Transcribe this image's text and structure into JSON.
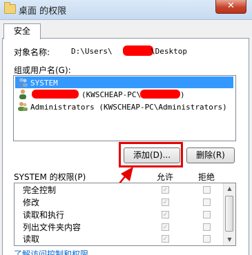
{
  "window": {
    "title": "桌面 的权限",
    "close_label": "✕"
  },
  "tabs": [
    {
      "label": "安全"
    }
  ],
  "object": {
    "label": "对象名称:",
    "path_prefix": "D:\\Users\\",
    "path_suffix": "\\Desktop"
  },
  "groups": {
    "label": "组或用户名(G):",
    "items": [
      {
        "name": "SYSTEM",
        "selected": true
      },
      {
        "name": "(KWSCHEAP-PC\\",
        "suffix": ")"
      },
      {
        "name": "Administrators (KWSCHEAP-PC\\Administrators)"
      }
    ]
  },
  "buttons": {
    "add": "添加(D)...",
    "remove": "删除(R)"
  },
  "permissions": {
    "label": "SYSTEM 的权限(P)",
    "allow_header": "允许",
    "deny_header": "拒绝",
    "rows": [
      {
        "name": "完全控制",
        "allow": true,
        "deny": false
      },
      {
        "name": "修改",
        "allow": true,
        "deny": false
      },
      {
        "name": "读取和执行",
        "allow": true,
        "deny": false
      },
      {
        "name": "列出文件夹内容",
        "allow": true,
        "deny": false
      },
      {
        "name": "读取",
        "allow": true,
        "deny": false
      }
    ]
  },
  "link": "了解访问控制和权限"
}
